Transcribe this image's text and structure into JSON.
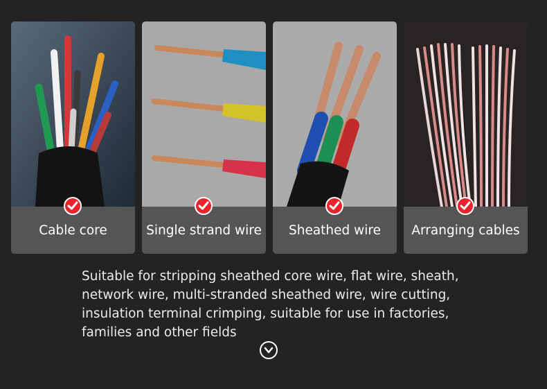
{
  "cards": [
    {
      "label": "Cable core"
    },
    {
      "label": "Single strand wire"
    },
    {
      "label": "Sheathed wire"
    },
    {
      "label": "Arranging cables"
    }
  ],
  "description": {
    "lines": [
      "Suitable for stripping sheathed core wire, flat wire, sheath,",
      "network wire, multi-stranded sheathed wire, wire cutting,",
      "insulation terminal crimping, suitable for use in factories,",
      "families and other fields"
    ]
  },
  "icons": {
    "check": "check-circle-icon",
    "scroll": "chevron-down-circle-icon"
  },
  "colors": {
    "background": "#232323",
    "card": "#555555",
    "check": "#e8232b"
  }
}
